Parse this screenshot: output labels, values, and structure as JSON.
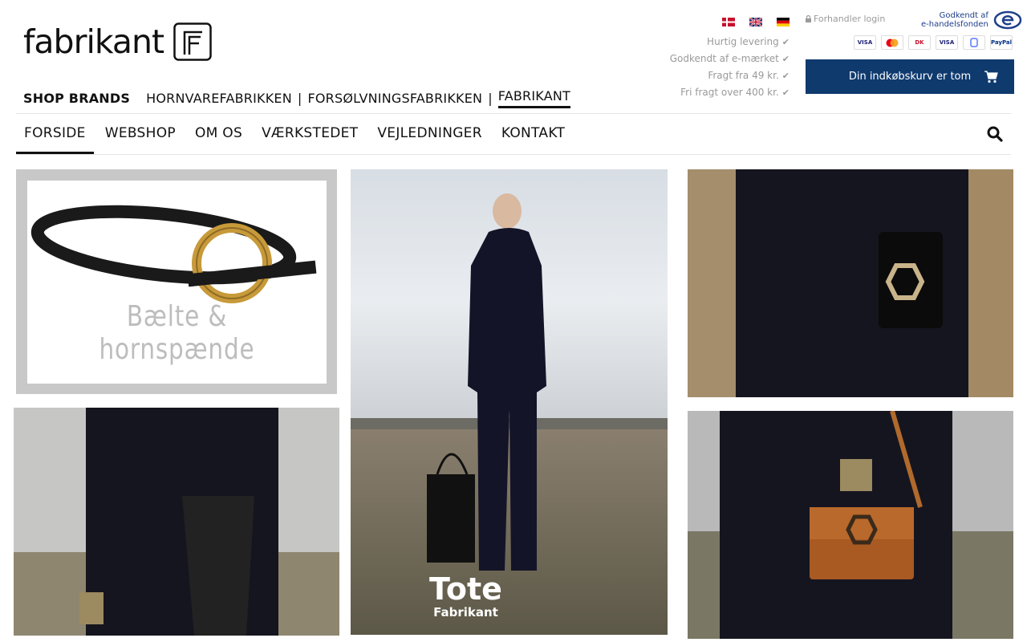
{
  "logo": {
    "text": "fabrikant"
  },
  "brands": {
    "label": "SHOP BRANDS",
    "items": [
      "HORNVAREFABRIKKEN",
      "FORSØLVNINGSFABRIKKEN",
      "FABRIKANT"
    ],
    "separator": "|",
    "active": "FABRIKANT"
  },
  "usp": [
    "Hurtig levering",
    "Godkendt af e-mærket",
    "Fragt fra 49 kr.",
    "Fri fragt over 400 kr."
  ],
  "flags": [
    "danish-flag",
    "english-flag",
    "german-flag"
  ],
  "dealer_login": "Forhandler login",
  "emark": {
    "line1": "Godkendt af",
    "line2": "e-handelsfonden"
  },
  "payments": [
    "VISA",
    "Mastercard",
    "Dankort",
    "VISA",
    "MobilePay",
    "PayPal"
  ],
  "cart": {
    "label": "Din indkøbskurv er tom"
  },
  "nav": {
    "items": [
      "FORSIDE",
      "WEBSHOP",
      "OM OS",
      "VÆRKSTEDET",
      "VEJLEDNINGER",
      "KONTAKT"
    ],
    "active": "FORSIDE"
  },
  "tiles": {
    "belt_caption": "Bælte & hornspænde",
    "tote_title": "Tote",
    "tote_subtitle": "Fabrikant"
  },
  "colors": {
    "accent": "#0f3a6e",
    "muted": "#9a9a9a",
    "text": "#111111"
  }
}
